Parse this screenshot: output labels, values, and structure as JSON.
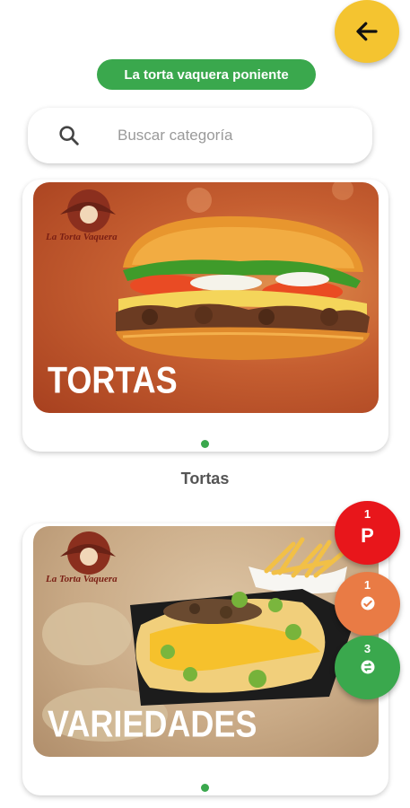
{
  "header": {
    "back_button_icon": "arrow-left-icon",
    "store_name": "La torta vaquera poniente"
  },
  "search": {
    "placeholder": "Buscar categoría",
    "icon": "search-icon"
  },
  "categories": [
    {
      "banner_title": "TORTAS",
      "logo_text": "La Torta Vaquera",
      "label": "Tortas"
    },
    {
      "banner_title": "VARIEDADES",
      "logo_text": "La Torta Vaquera",
      "label": ""
    }
  ],
  "floating_actions": [
    {
      "count": "1",
      "glyph": "P",
      "color": "#e8161b"
    },
    {
      "count": "1",
      "icon": "clock-check-icon",
      "color": "#e97b45"
    },
    {
      "count": "3",
      "icon": "swap-icon",
      "color": "#3aa84d"
    }
  ],
  "colors": {
    "accent_green": "#3aa84d",
    "back_button_yellow": "#f4c430"
  }
}
